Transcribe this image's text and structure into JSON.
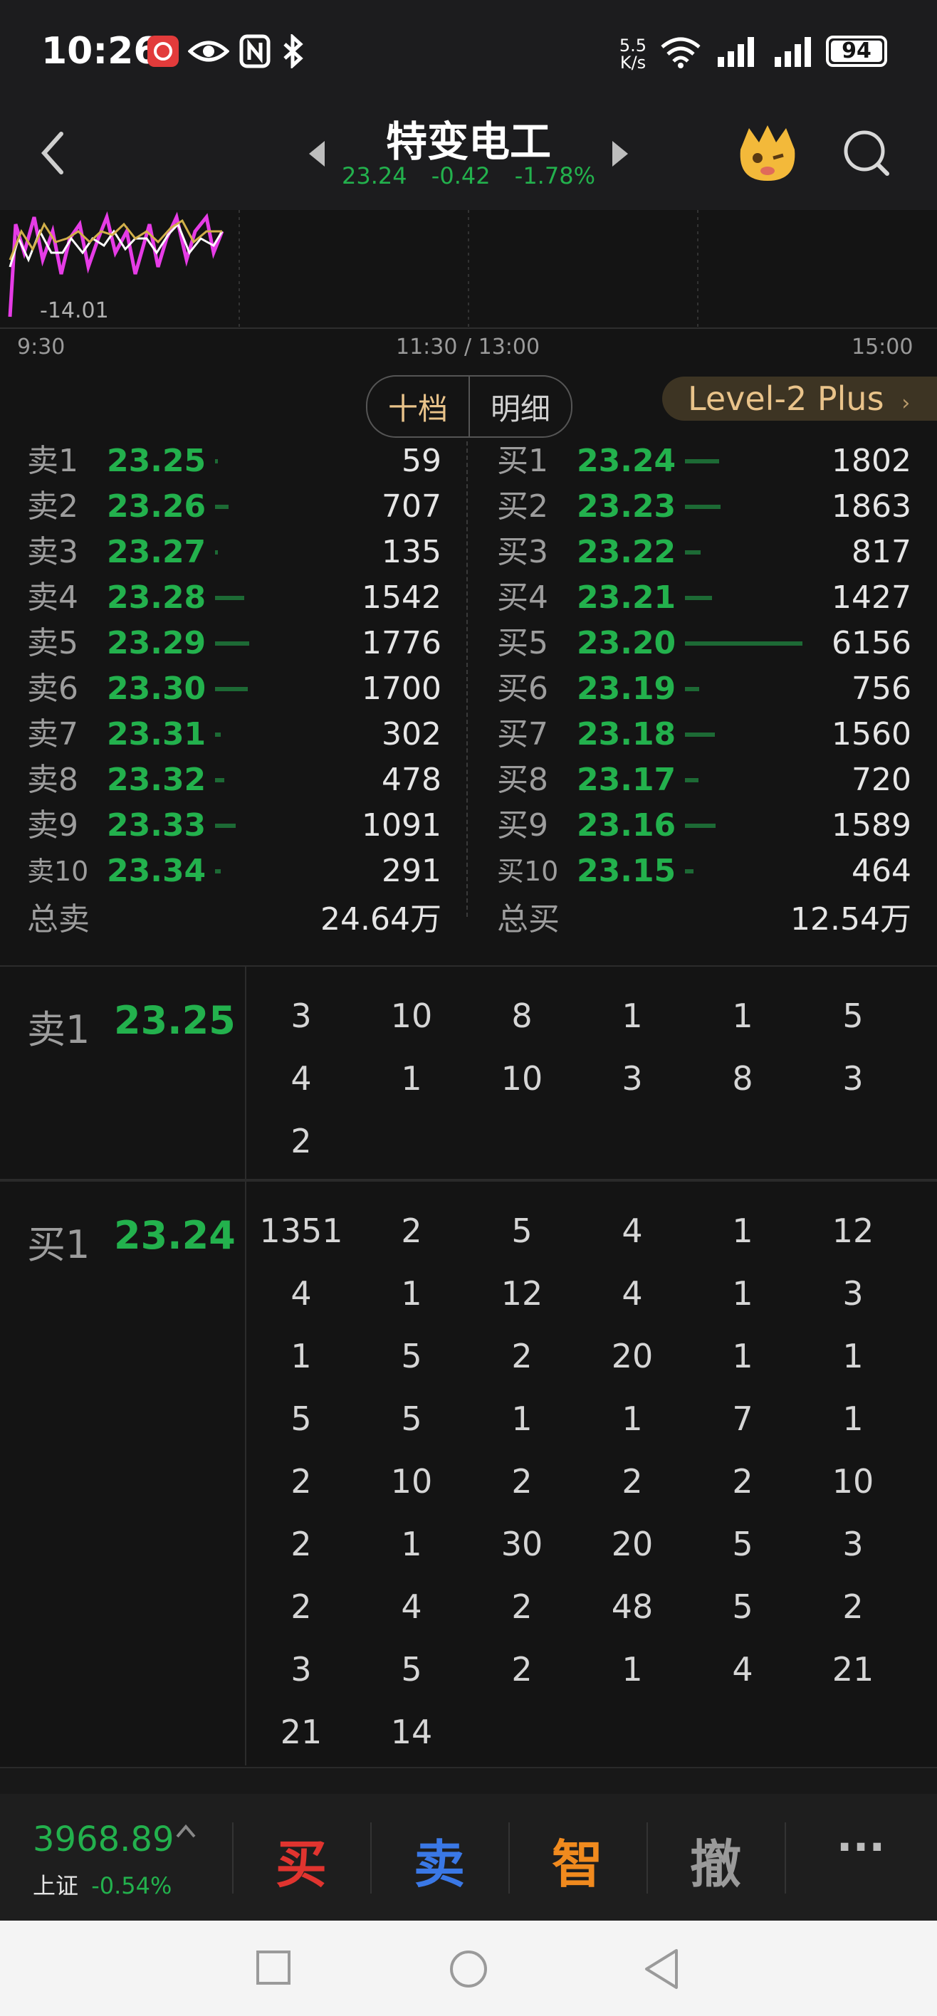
{
  "status": {
    "time": "10:26",
    "net_speed_value": "5.5",
    "net_speed_unit": "K/s",
    "battery": "94",
    "icons": [
      "app-notification-icon",
      "eye-icon",
      "nfc-icon",
      "bluetooth-icon",
      "wifi-icon",
      "signal-icon",
      "signal-icon-2",
      "battery-icon"
    ]
  },
  "header": {
    "stock_name": "特变电工",
    "price": "23.24",
    "change": "-0.42",
    "change_pct": "-1.78%"
  },
  "chart": {
    "min_label": "-14.01",
    "time_start": "9:30",
    "time_mid": "11:30 / 13:00",
    "time_end": "15:00"
  },
  "tabs": {
    "ten_levels": "十档",
    "detail": "明细",
    "level2": "Level-2 Plus"
  },
  "order_book": {
    "asks": [
      {
        "label": "卖1",
        "price": "23.25",
        "volume": "59"
      },
      {
        "label": "卖2",
        "price": "23.26",
        "volume": "707"
      },
      {
        "label": "卖3",
        "price": "23.27",
        "volume": "135"
      },
      {
        "label": "卖4",
        "price": "23.28",
        "volume": "1542"
      },
      {
        "label": "卖5",
        "price": "23.29",
        "volume": "1776"
      },
      {
        "label": "卖6",
        "price": "23.30",
        "volume": "1700"
      },
      {
        "label": "卖7",
        "price": "23.31",
        "volume": "302"
      },
      {
        "label": "卖8",
        "price": "23.32",
        "volume": "478"
      },
      {
        "label": "卖9",
        "price": "23.33",
        "volume": "1091"
      },
      {
        "label": "卖10",
        "price": "23.34",
        "volume": "291"
      }
    ],
    "bids": [
      {
        "label": "买1",
        "price": "23.24",
        "volume": "1802"
      },
      {
        "label": "买2",
        "price": "23.23",
        "volume": "1863"
      },
      {
        "label": "买3",
        "price": "23.22",
        "volume": "817"
      },
      {
        "label": "买4",
        "price": "23.21",
        "volume": "1427"
      },
      {
        "label": "买5",
        "price": "23.20",
        "volume": "6156"
      },
      {
        "label": "买6",
        "price": "23.19",
        "volume": "756"
      },
      {
        "label": "买7",
        "price": "23.18",
        "volume": "1560"
      },
      {
        "label": "买8",
        "price": "23.17",
        "volume": "720"
      },
      {
        "label": "买9",
        "price": "23.16",
        "volume": "1589"
      },
      {
        "label": "买10",
        "price": "23.15",
        "volume": "464"
      }
    ],
    "total_sell_label": "总卖",
    "total_sell": "24.64万",
    "total_buy_label": "总买",
    "total_buy": "12.54万"
  },
  "queues": {
    "sell": {
      "label": "卖1",
      "price": "23.25",
      "orders": [
        "3",
        "10",
        "8",
        "1",
        "1",
        "5",
        "4",
        "1",
        "10",
        "3",
        "8",
        "3",
        "2"
      ]
    },
    "buy": {
      "label": "买1",
      "price": "23.24",
      "orders": [
        "1351",
        "2",
        "5",
        "4",
        "1",
        "12",
        "4",
        "1",
        "12",
        "4",
        "1",
        "3",
        "1",
        "5",
        "2",
        "20",
        "1",
        "1",
        "5",
        "5",
        "1",
        "1",
        "7",
        "1",
        "2",
        "10",
        "2",
        "2",
        "2",
        "10",
        "2",
        "1",
        "30",
        "20",
        "5",
        "3",
        "2",
        "4",
        "2",
        "48",
        "5",
        "2",
        "3",
        "5",
        "2",
        "1",
        "4",
        "21",
        "21",
        "14"
      ]
    }
  },
  "bottom": {
    "index_value": "3968.89",
    "index_name": "上证",
    "index_change": "-0.54%",
    "buy": "买",
    "sell": "卖",
    "smart": "智",
    "cancel": "撤",
    "more": "···"
  },
  "colors": {
    "up": "#e0342f",
    "down": "#23b14d",
    "gold": "#e9c38a",
    "blue": "#3a78e6",
    "orange": "#f08a1e"
  }
}
